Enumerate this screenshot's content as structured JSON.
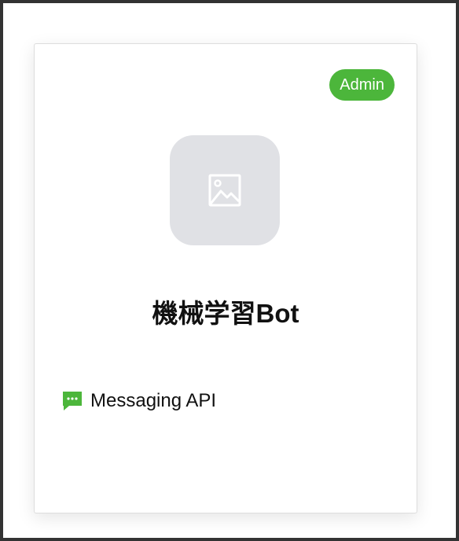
{
  "card": {
    "badge": "Admin",
    "title": "機械学習Bot",
    "channel_type": "Messaging API"
  },
  "icons": {
    "avatar_placeholder": "image-placeholder-icon",
    "channel": "chat-bubble-icon"
  },
  "colors": {
    "badge_bg": "#4cb63b",
    "channel_icon": "#4cb63b",
    "avatar_bg": "#e0e1e5"
  }
}
